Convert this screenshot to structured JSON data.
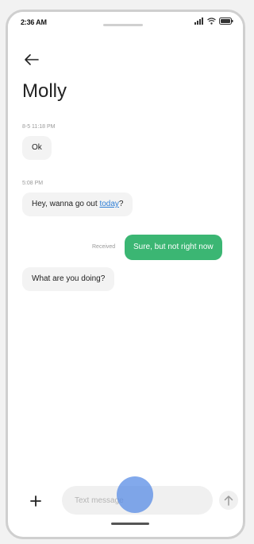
{
  "status_bar": {
    "time": "2:36 AM",
    "icons": [
      "signal-icon",
      "wifi-icon",
      "battery-icon"
    ]
  },
  "header": {
    "back_icon": "arrow-left-icon",
    "title": "Molly"
  },
  "messages": [
    {
      "timestamp": "8-5 11:18 PM",
      "text": "Ok",
      "direction": "incoming"
    },
    {
      "timestamp": "5:08 PM",
      "text_before": "Hey, wanna go out ",
      "link": "today",
      "text_after": "?",
      "direction": "incoming"
    },
    {
      "status": "Received",
      "text": "Sure, but not right now",
      "direction": "outgoing"
    },
    {
      "text": "What are you doing?",
      "direction": "incoming"
    }
  ],
  "composer": {
    "add_icon": "plus-icon",
    "placeholder": "Text message",
    "send_icon": "arrow-up-icon"
  },
  "colors": {
    "outgoing_bubble": "#3bb673",
    "incoming_bubble": "#f3f3f3",
    "link": "#2f7fd6",
    "touch_indicator": "#588ce6"
  }
}
